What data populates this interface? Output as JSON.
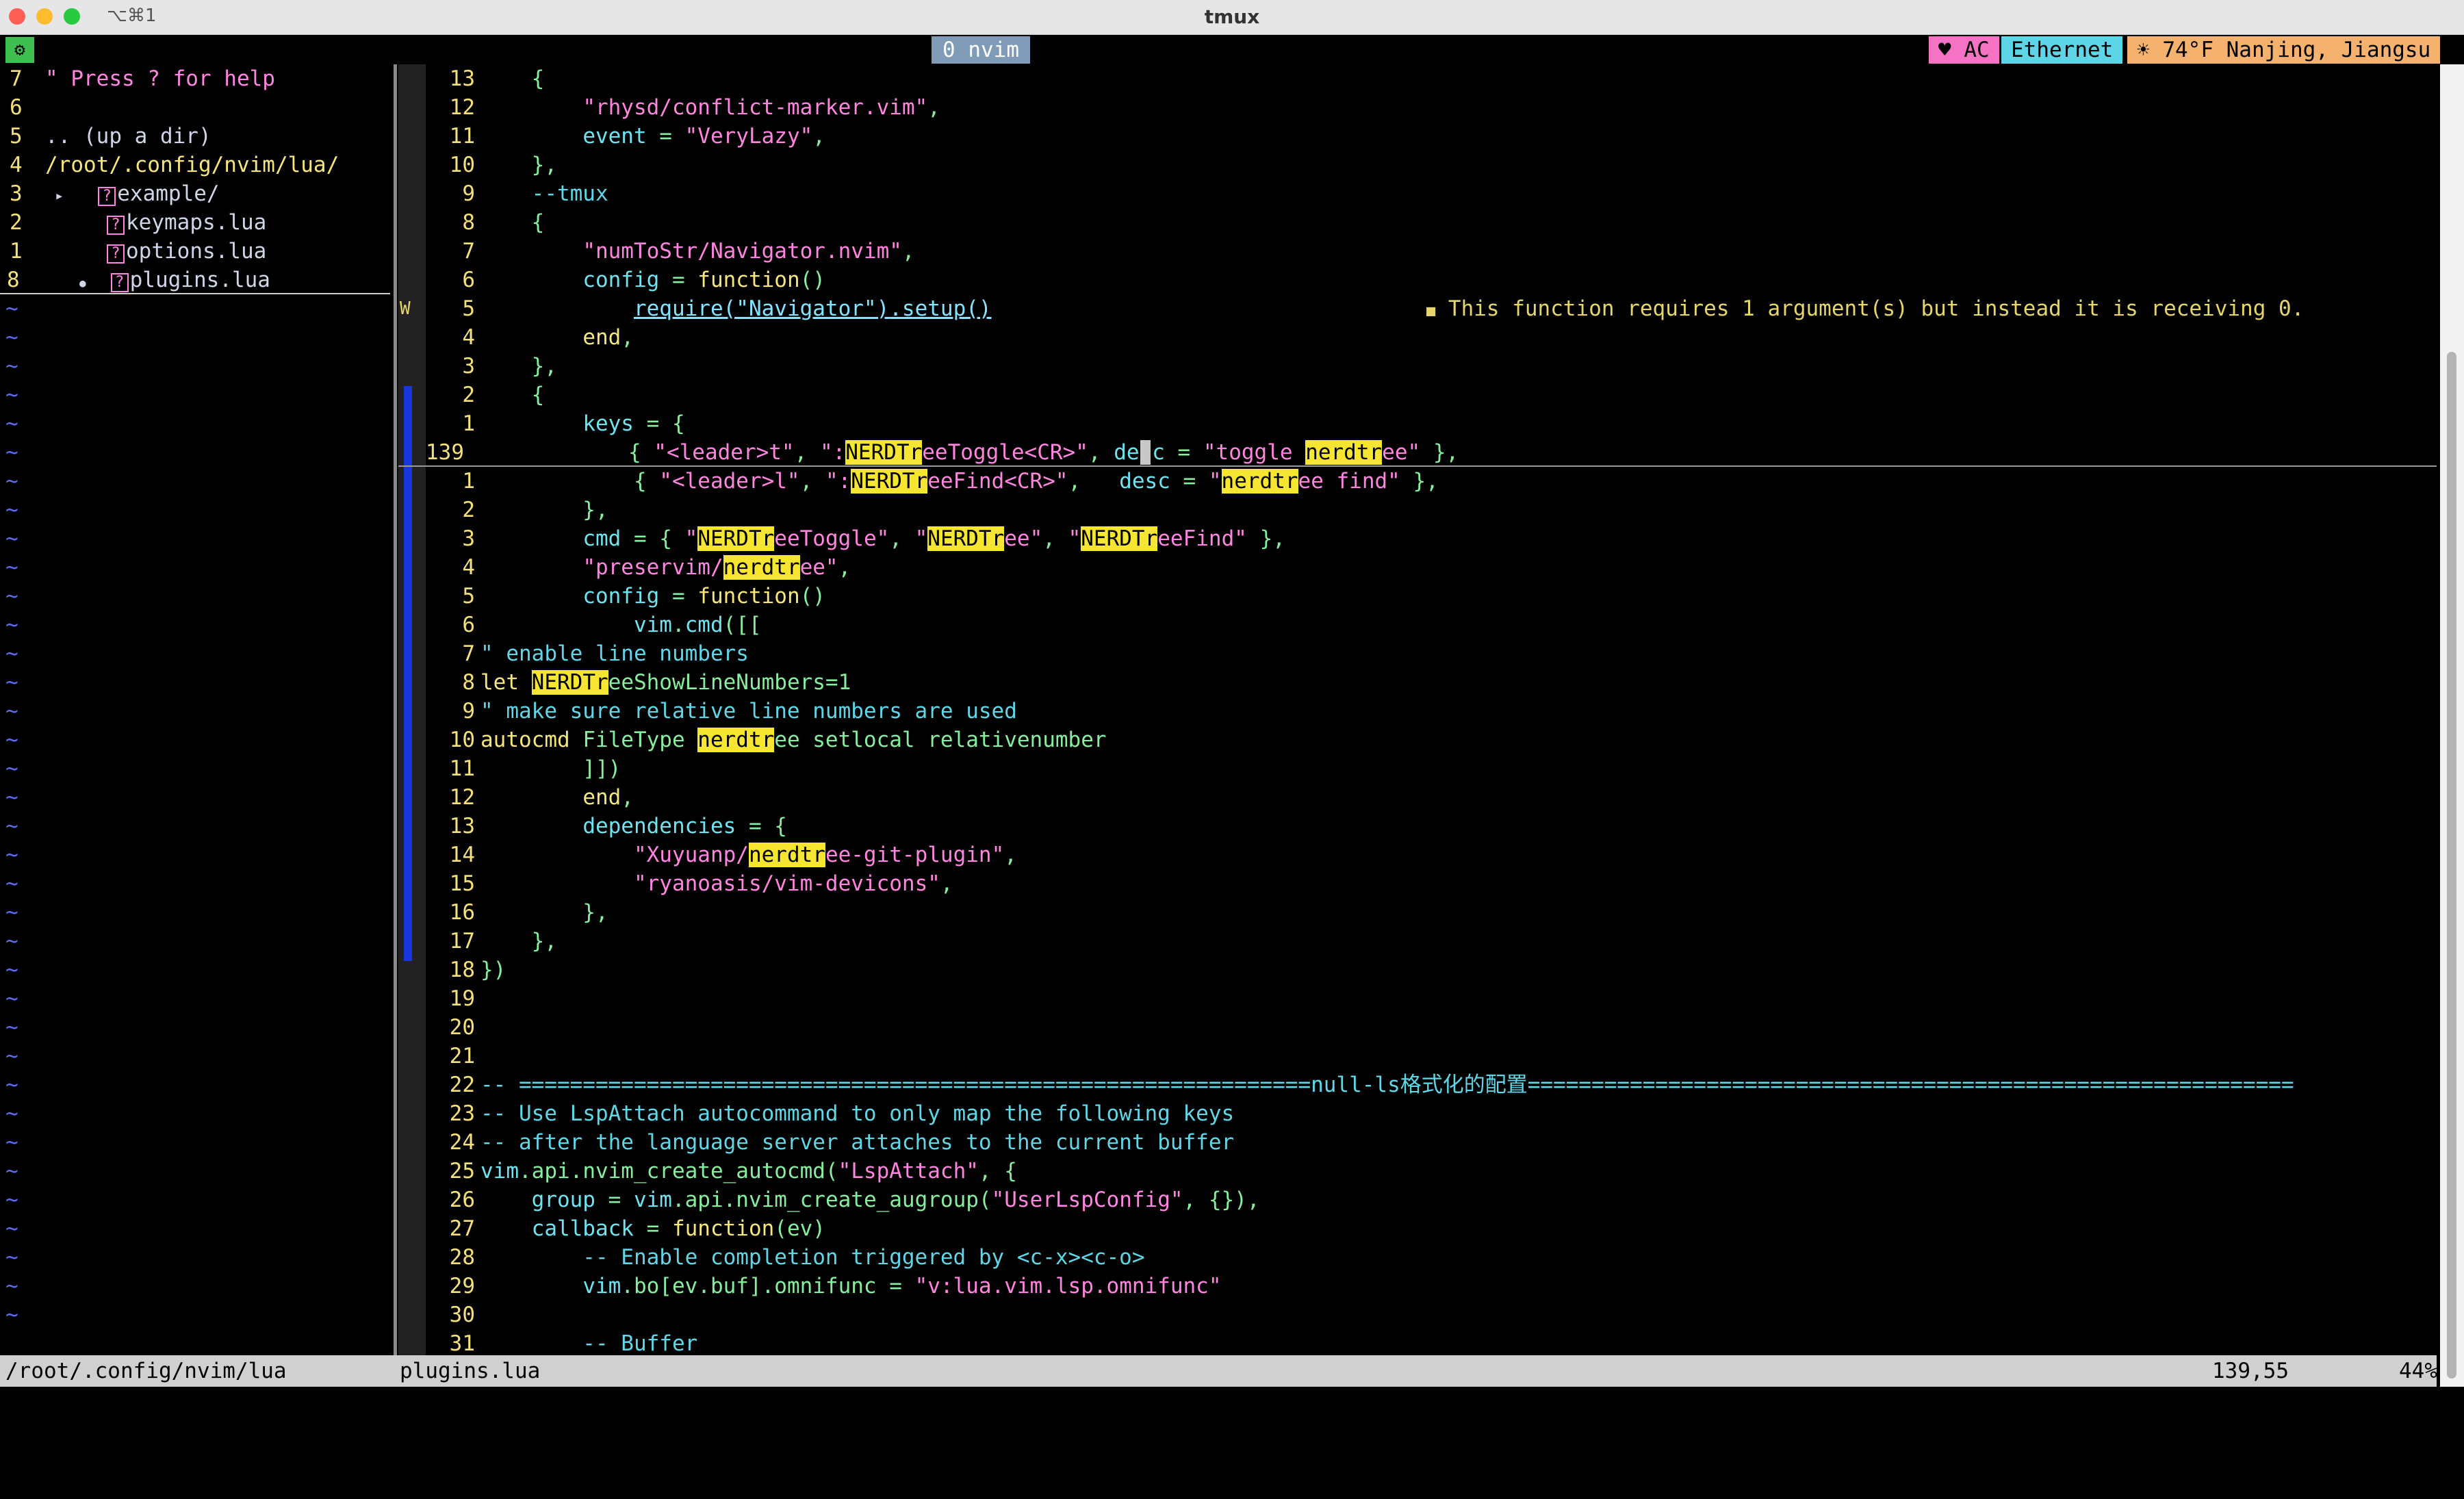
{
  "window": {
    "title": "tmux",
    "shortcut": "⌥⌘1"
  },
  "tmux": {
    "session_icon": "⚙",
    "window_label": "0 nvim",
    "status_right": {
      "power": "♥ AC",
      "network": "Ethernet",
      "weather": "☀ 74°F Nanjing, Jiangsu"
    }
  },
  "tree": {
    "lines": [
      {
        "num": "7",
        "text": "\" Press ? for help"
      },
      {
        "num": "6",
        "text": ""
      },
      {
        "num": "5",
        "text": ".. (up a dir)"
      },
      {
        "num": "4",
        "text": "/root/.config/nvim/lua/"
      },
      {
        "num": "3",
        "text": "example/",
        "arrow": "▸",
        "icon": "?"
      },
      {
        "num": "2",
        "text": "keymaps.lua",
        "icon": "?"
      },
      {
        "num": "1",
        "text": "options.lua",
        "icon": "?"
      },
      {
        "num": "8",
        "text": "plugins.lua",
        "icon": "?",
        "bullet": "●"
      }
    ],
    "tilde": "~"
  },
  "code": {
    "lines": [
      {
        "num": "13",
        "text": "    {"
      },
      {
        "num": "12",
        "text": "        \"rhysd/conflict-marker.vim\","
      },
      {
        "num": "11",
        "text": "        event = \"VeryLazy\","
      },
      {
        "num": "10",
        "text": "    },"
      },
      {
        "num": "9",
        "text": "    --tmux"
      },
      {
        "num": "8",
        "text": "    {"
      },
      {
        "num": "7",
        "text": "        \"numToStr/Navigator.nvim\","
      },
      {
        "num": "6",
        "text": "        config = function()"
      },
      {
        "num": "5",
        "text": "            require(\"Navigator\").setup()"
      },
      {
        "num": "4",
        "text": "        end,"
      },
      {
        "num": "3",
        "text": "    },"
      },
      {
        "num": "2",
        "text": "    {"
      },
      {
        "num": "1",
        "text": "        keys = {"
      },
      {
        "num": "139",
        "text": "            { \"<leader>t\", \":NERDTreeToggle<CR>\", desc = \"toggle nerdtree\" },"
      },
      {
        "num": "1",
        "text": "            { \"<leader>l\", \":NERDTreeFind<CR>\",   desc = \"nerdtree find\" },"
      },
      {
        "num": "2",
        "text": "        },"
      },
      {
        "num": "3",
        "text": "        cmd = { \"NERDTreeToggle\", \"NERDTree\", \"NERDTreeFind\" },"
      },
      {
        "num": "4",
        "text": "        \"preservim/nerdtree\","
      },
      {
        "num": "5",
        "text": "        config = function()"
      },
      {
        "num": "6",
        "text": "            vim.cmd([["
      },
      {
        "num": "7",
        "text": "\" enable line numbers"
      },
      {
        "num": "8",
        "text": "let NERDTreeShowLineNumbers=1"
      },
      {
        "num": "9",
        "text": "\" make sure relative line numbers are used"
      },
      {
        "num": "10",
        "text": "autocmd FileType nerdtree setlocal relativenumber"
      },
      {
        "num": "11",
        "text": "        ]])"
      },
      {
        "num": "12",
        "text": "        end,"
      },
      {
        "num": "13",
        "text": "        dependencies = {"
      },
      {
        "num": "14",
        "text": "            \"Xuyuanp/nerdtree-git-plugin\","
      },
      {
        "num": "15",
        "text": "            \"ryanoasis/vim-devicons\","
      },
      {
        "num": "16",
        "text": "        },"
      },
      {
        "num": "17",
        "text": "    },"
      },
      {
        "num": "18",
        "text": "})"
      },
      {
        "num": "19",
        "text": ""
      },
      {
        "num": "20",
        "text": ""
      },
      {
        "num": "21",
        "text": ""
      },
      {
        "num": "22",
        "text": "-- ==============================================================null-ls格式化的配置============================================================"
      },
      {
        "num": "23",
        "text": "-- Use LspAttach autocommand to only map the following keys"
      },
      {
        "num": "24",
        "text": "-- after the language server attaches to the current buffer"
      },
      {
        "num": "25",
        "text": "vim.api.nvim_create_autocmd(\"LspAttach\", {"
      },
      {
        "num": "26",
        "text": "    group = vim.api.nvim_create_augroup(\"UserLspConfig\", {}),"
      },
      {
        "num": "27",
        "text": "    callback = function(ev)"
      },
      {
        "num": "28",
        "text": "        -- Enable completion triggered by <c-x><c-o>"
      },
      {
        "num": "29",
        "text": "        vim.bo[ev.buf].omnifunc = \"v:lua.vim.lsp.omnifunc\""
      },
      {
        "num": "30",
        "text": ""
      },
      {
        "num": "31",
        "text": "        -- Buffer"
      }
    ],
    "diagnostic": {
      "sign": "W",
      "bullet": "■",
      "message": "This function requires 1 argument(s) but instead it is receiving 0."
    }
  },
  "status": {
    "tree_path": "/root/.config/nvim/lua",
    "file": "plugins.lua",
    "position": "139,55",
    "percent": "44%"
  },
  "colors": {
    "highlight": "#f6e631",
    "linenr": "#f4e07a",
    "string": "#ff85e0",
    "sign_git": "#1a36e0"
  }
}
